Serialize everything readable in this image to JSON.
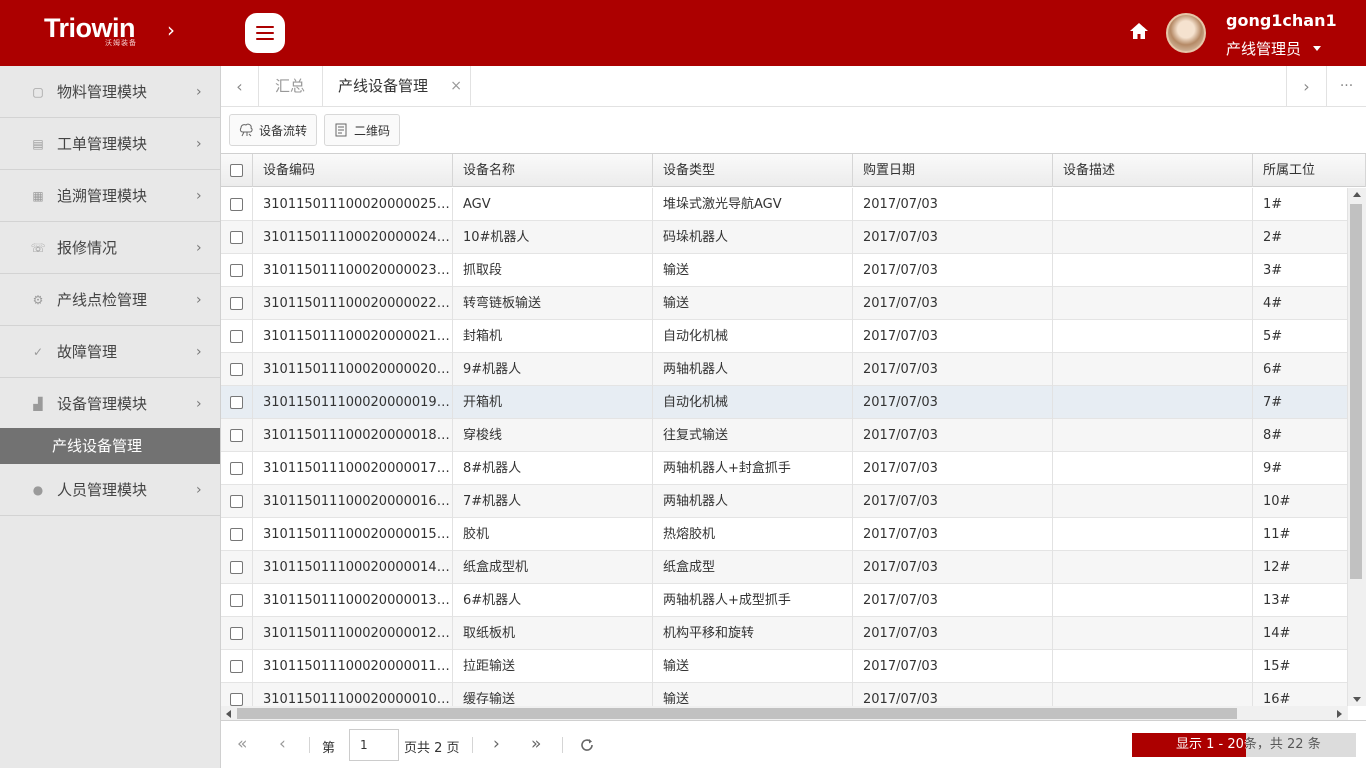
{
  "header": {
    "logo": "Triowin",
    "logo_sub": "沃姆装备",
    "username": "gong1chan1",
    "role": "产线管理员",
    "colors": {
      "brand": "#ac0000"
    }
  },
  "sidebar": {
    "items": [
      {
        "label": "物料管理模块",
        "icon": "box-icon"
      },
      {
        "label": "工单管理模块",
        "icon": "document-icon"
      },
      {
        "label": "追溯管理模块",
        "icon": "grid-icon"
      },
      {
        "label": "报修情况",
        "icon": "phone-icon"
      },
      {
        "label": "产线点检管理",
        "icon": "gear-icon"
      },
      {
        "label": "故障管理",
        "icon": "check-icon"
      },
      {
        "label": "设备管理模块",
        "icon": "machine-icon"
      },
      {
        "label": "人员管理模块",
        "icon": "user-icon"
      }
    ],
    "active_sub": "产线设备管理"
  },
  "tabs": [
    {
      "label": "汇总",
      "active": false
    },
    {
      "label": "产线设备管理",
      "active": true,
      "close": "×"
    }
  ],
  "toolbar": {
    "transfer_label": "设备流转",
    "qrcode_label": "二维码"
  },
  "grid": {
    "columns": [
      "设备编码",
      "设备名称",
      "设备类型",
      "购置日期",
      "设备描述",
      "所属工位"
    ],
    "rows": [
      [
        "310115011100020000025​2...",
        "AGV",
        "堆垛式激光导航AGV",
        "2017/07/03",
        "",
        "1#"
      ],
      [
        "3101150111000200000242...",
        "10#机器人",
        "码垛机器人",
        "2017/07/03",
        "",
        "2#"
      ],
      [
        "3101150111000200000232...",
        "抓取段",
        "输送",
        "2017/07/03",
        "",
        "3#"
      ],
      [
        "3101150111000200000222...",
        "转弯链板输送",
        "输送",
        "2017/07/03",
        "",
        "4#"
      ],
      [
        "3101150111000200000212...",
        "封箱机",
        "自动化机械",
        "2017/07/03",
        "",
        "5#"
      ],
      [
        "3101150111000200000202...",
        "9#机器人",
        "两轴机器人",
        "2017/07/03",
        "",
        "6#"
      ],
      [
        "3101150111000200000192...",
        "开箱机",
        "自动化机械",
        "2017/07/03",
        "",
        "7#"
      ],
      [
        "3101150111000200000182...",
        "穿梭线",
        "往复式输送",
        "2017/07/03",
        "",
        "8#"
      ],
      [
        "3101150111000200000172...",
        "8#机器人",
        "两轴机器人+封盒抓手",
        "2017/07/03",
        "",
        "9#"
      ],
      [
        "3101150111000200000162...",
        "7#机器人",
        "两轴机器人",
        "2017/07/03",
        "",
        "10#"
      ],
      [
        "3101150111000200000152...",
        "胶机",
        "热熔胶机",
        "2017/07/03",
        "",
        "11#"
      ],
      [
        "3101150111000200000142...",
        "纸盒成型机",
        "纸盒成型",
        "2017/07/03",
        "",
        "12#"
      ],
      [
        "3101150111000200000132...",
        "6#机器人",
        "两轴机器人+成型抓手",
        "2017/07/03",
        "",
        "13#"
      ],
      [
        "3101150111000200000122...",
        "取纸板机",
        "机构平移和旋转",
        "2017/07/03",
        "",
        "14#"
      ],
      [
        "3101150111000200000112...",
        "拉距输送",
        "输送",
        "2017/07/03",
        "",
        "15#"
      ],
      [
        "3101150111000200000102...",
        "缓存输送",
        "输送",
        "2017/07/03",
        "",
        "16#"
      ]
    ]
  },
  "pager": {
    "page_prefix": "第",
    "page_value": "1",
    "page_suffix": "页共 2 页",
    "info": "显示 1 - 20条，共 22 条"
  }
}
